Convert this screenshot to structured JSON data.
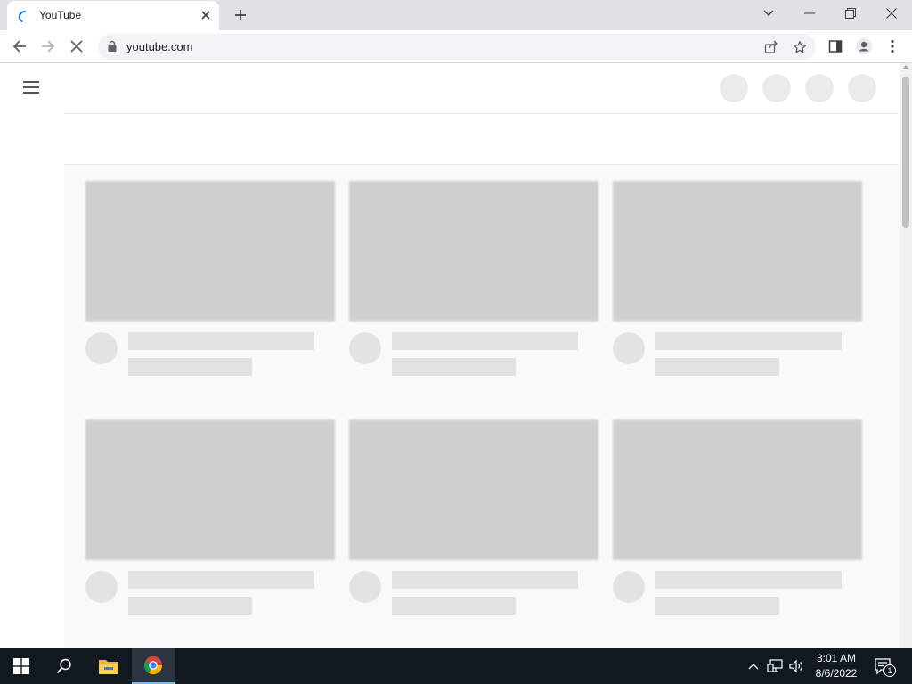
{
  "browser": {
    "tab_title": "YouTube",
    "url": "youtube.com"
  },
  "page": {
    "masthead_placeholder_count": 4,
    "video_rows": [
      {
        "cards": 3
      },
      {
        "cards": 3
      }
    ]
  },
  "taskbar": {
    "time": "3:01 AM",
    "date": "8/6/2022",
    "notification_count": "1"
  },
  "colors": {
    "tab_strip": "#dee1e6",
    "skeleton_thumb": "#cfcfcf",
    "skeleton_line": "#e3e3e3",
    "taskbar": "#101820",
    "loading_spinner": "#1a73e8"
  },
  "icons": {
    "favicon": "loading-spinner-icon",
    "back": "arrow-left-icon",
    "forward": "arrow-right-icon",
    "stop": "close-icon",
    "lock": "lock-icon",
    "share": "share-icon",
    "bookmark": "star-icon",
    "sidepanel": "side-panel-icon",
    "profile": "profile-icon",
    "menu": "kebab-menu-icon"
  }
}
